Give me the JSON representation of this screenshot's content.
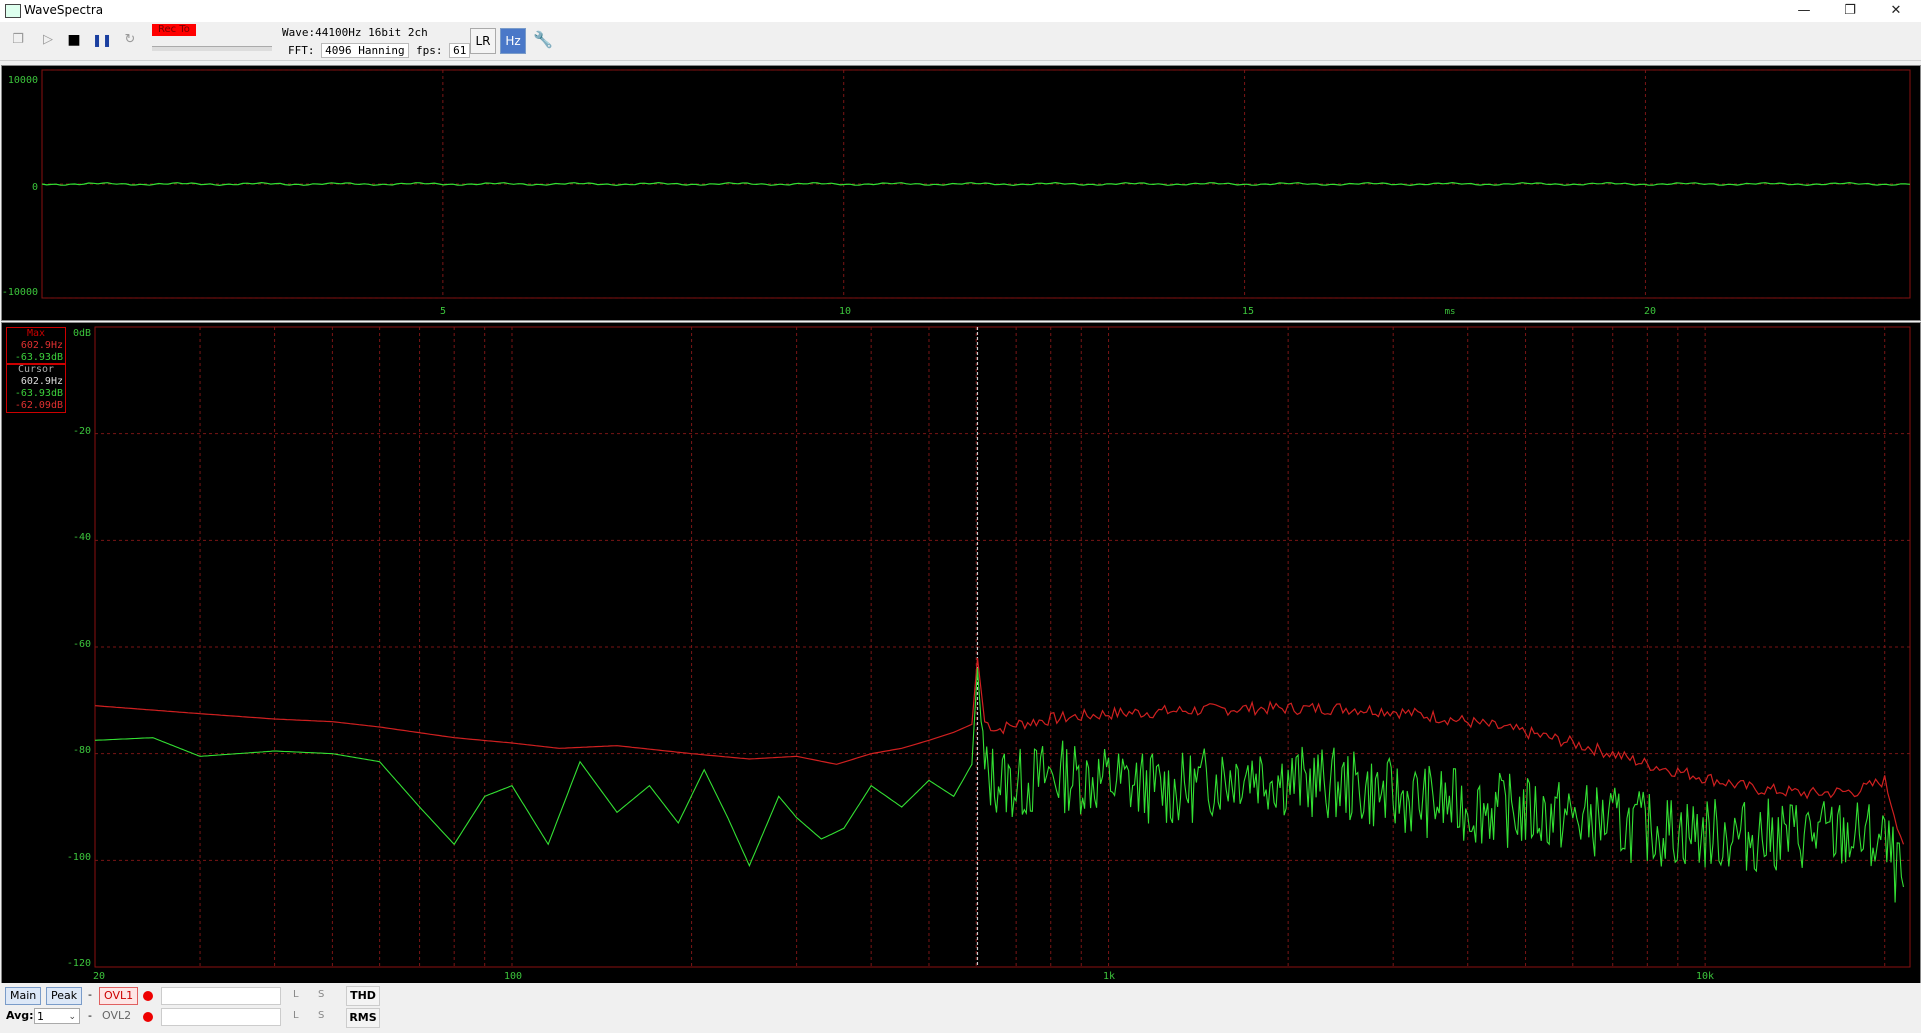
{
  "window": {
    "title": "WaveSpectra",
    "controls": [
      "—",
      "❐",
      "✕"
    ]
  },
  "toolbar": {
    "rec_badge": "Rec To",
    "wave_label": "Wave:",
    "wave_value": "44100Hz 16bit 2ch",
    "fft_label": "FFT:",
    "fft_value": "4096 Hanning",
    "fps_label": "fps:",
    "fps_value": "61",
    "lr_button": "LR",
    "hz_button": "Hz"
  },
  "waveform": {
    "y_ticks": [
      "10000",
      "0",
      "-10000"
    ],
    "x_ticks": [
      "5",
      "10",
      "15",
      "20"
    ],
    "x_unit": "ms"
  },
  "spectrum": {
    "y_ticks": [
      "0dB",
      "-20",
      "-40",
      "-60",
      "-80",
      "-100",
      "-120"
    ],
    "x_ticks": [
      "20",
      "100",
      "1k",
      "10k"
    ],
    "legend_max": {
      "title": "Max",
      "freq": "602.9Hz",
      "level": "-63.93dB"
    },
    "legend_cursor": {
      "title": "Cursor",
      "freq": "602.9Hz",
      "level1": "-63.93dB",
      "level2": "-62.09dB"
    }
  },
  "bottom": {
    "main_button": "Main",
    "peak_button": "Peak",
    "dash": "-",
    "ovl1": "OVL1",
    "ovl2": "OVL2",
    "l_label": "L",
    "s_label": "S",
    "thd_button": "THD",
    "rms_button": "RMS",
    "avg_label": "Avg:",
    "avg_value": "1"
  },
  "colors": {
    "trace_green": "#33e033",
    "trace_red": "#d02020",
    "grid": "#7a1515",
    "axis_green": "#3cc43c"
  },
  "chart_data": [
    {
      "type": "line",
      "xlabel": "ms",
      "ylim": [
        -10000,
        10000
      ],
      "xlim": [
        0,
        23.3
      ],
      "series": [
        {
          "x": [
            0,
            5,
            10,
            15,
            20,
            23.3
          ],
          "y": [
            0,
            0,
            0,
            0,
            0,
            0
          ]
        }
      ]
    },
    {
      "type": "line",
      "xscale": "log",
      "ylabel": "dB",
      "ylim": [
        -120,
        0
      ],
      "xlim": [
        20,
        22050
      ],
      "series": [
        {
          "x": [
            20,
            30,
            40,
            50,
            60,
            80,
            100,
            120,
            150,
            200,
            250,
            300,
            350,
            400,
            450,
            500,
            550,
            590,
            602.9,
            620,
            650,
            700,
            800,
            1000,
            1300,
            1700,
            2000,
            2500,
            3000,
            3500,
            4000,
            5000,
            6000,
            7000,
            8000,
            10000,
            12000,
            15000,
            18000,
            20000,
            21500
          ],
          "y": [
            -71,
            -72.5,
            -73.5,
            -74,
            -75,
            -77,
            -78,
            -79,
            -78.5,
            -80,
            -81,
            -80.5,
            -82,
            -80,
            -79,
            -77.5,
            -76,
            -74.5,
            -62.09,
            -74,
            -75.5,
            -74.5,
            -73.5,
            -72.5,
            -72,
            -71.5,
            -71.5,
            -71.5,
            -72,
            -73,
            -74,
            -76,
            -78,
            -80,
            -82,
            -84.5,
            -86.5,
            -87.5,
            -87,
            -85,
            -97
          ]
        },
        {
          "x": [
            20,
            25,
            30,
            40,
            50,
            60,
            70,
            80,
            90,
            100,
            115,
            130,
            150,
            170,
            190,
            210,
            230,
            250,
            280,
            300,
            330,
            360,
            400,
            450,
            500,
            550,
            590,
            602.9,
            620,
            700,
            800,
            1000,
            1300,
            1700,
            2000,
            2500,
            3000,
            3500,
            4000,
            5000,
            6000,
            7000,
            8000,
            10000,
            12000,
            15000,
            18000,
            20000,
            21500
          ],
          "y": [
            -77.5,
            -77,
            -80.5,
            -79.5,
            -80,
            -81.5,
            -90,
            -97,
            -88,
            -86,
            -97,
            -81.5,
            -91,
            -86,
            -93,
            -83,
            -92,
            -101,
            -88,
            -92,
            -96,
            -94,
            -86,
            -90,
            -85,
            -88,
            -82,
            -63.93,
            -84,
            -86,
            -84,
            -85,
            -87,
            -83,
            -85,
            -86,
            -88,
            -89,
            -90,
            -91,
            -92,
            -93,
            -94,
            -95,
            -95.5,
            -95,
            -95.5,
            -97,
            -105
          ]
        }
      ]
    }
  ]
}
